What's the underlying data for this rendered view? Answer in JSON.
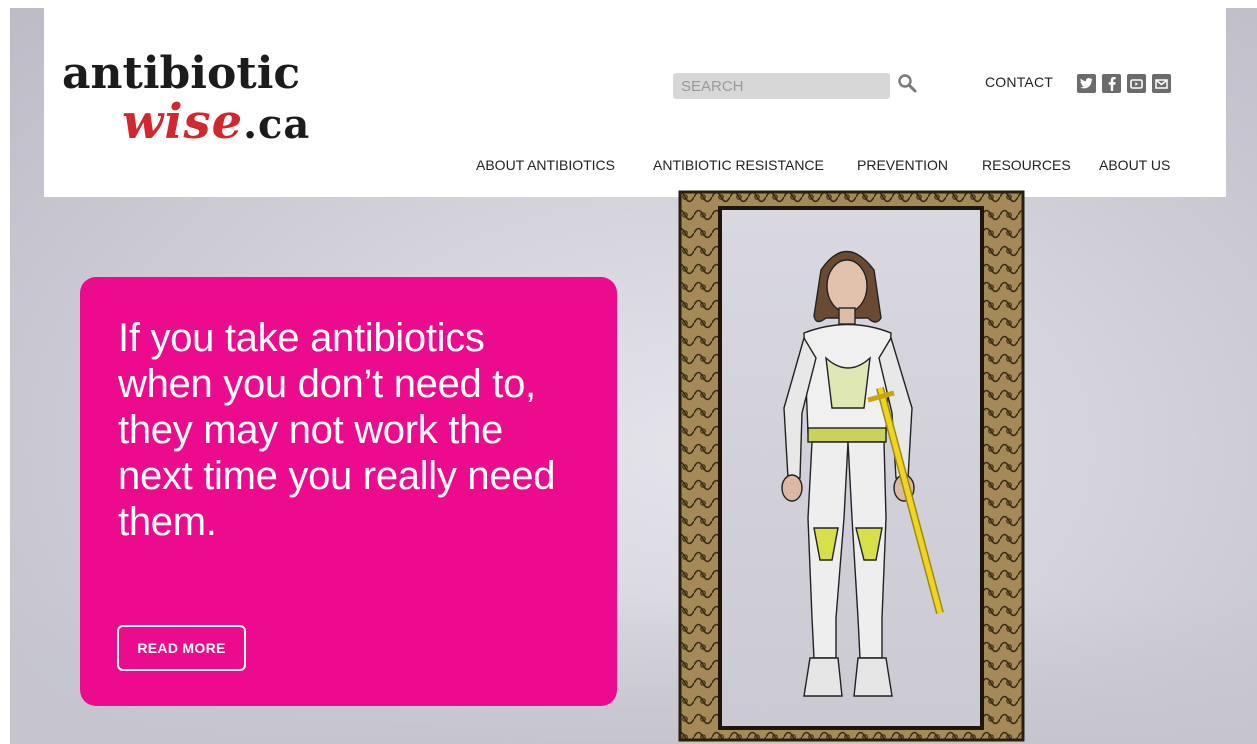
{
  "header": {
    "logo": {
      "line1": "antibiotic",
      "line2": "wise",
      "suffix": ".ca"
    },
    "search": {
      "placeholder": "SEARCH",
      "value": ""
    },
    "contact_label": "CONTACT",
    "social": [
      {
        "icon": "twitter-icon"
      },
      {
        "icon": "facebook-icon"
      },
      {
        "icon": "youtube-icon"
      },
      {
        "icon": "email-icon"
      }
    ],
    "nav": [
      {
        "label": "ABOUT ANTIBIOTICS"
      },
      {
        "label": "ANTIBIOTIC RESISTANCE"
      },
      {
        "label": "PREVENTION"
      },
      {
        "label": "RESOURCES"
      },
      {
        "label": "ABOUT US"
      }
    ]
  },
  "hero": {
    "headline": "If you take antibiotics when you don’t need to, they may not work the next time you really need them.",
    "button_label": "READ MORE"
  },
  "colors": {
    "brand_red": "#d0282e",
    "card_pink": "#ec0b8d",
    "frame_gold": "#a48a59"
  }
}
